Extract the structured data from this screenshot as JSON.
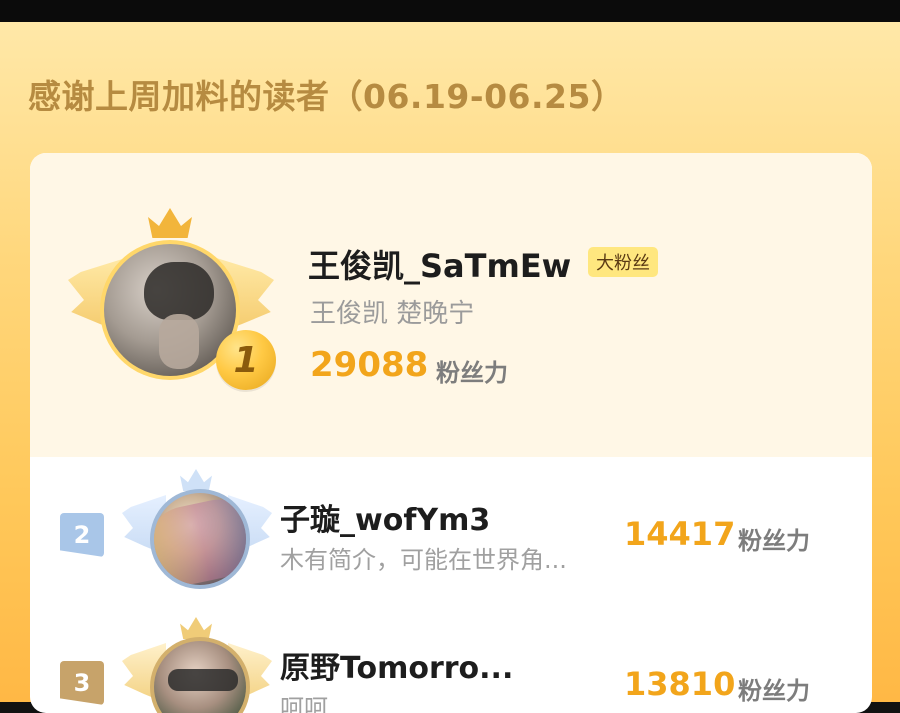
{
  "header": {
    "title": "感谢上周加料的读者（06.19-06.25）"
  },
  "top": {
    "rank": "1",
    "name": "王俊凯_SaTmEw",
    "tag": "大粉丝",
    "intro": "王俊凯 楚晚宁",
    "score": "29088",
    "score_unit": "粉丝力"
  },
  "list": [
    {
      "rank": "2",
      "name": "子璇_wofYm3",
      "intro": "木有简介，可能在世界角...",
      "score": "14417",
      "score_unit": "粉丝力"
    },
    {
      "rank": "3",
      "name": "原野Tomorro...",
      "intro": "呵呵",
      "score": "13810",
      "score_unit": "粉丝力"
    }
  ],
  "colors": {
    "score": "#f2a51b",
    "header": "#b68b41",
    "background_top": "#ffe8a8",
    "background_bottom": "#ffb845",
    "card_top_panel": "#fff7e6"
  },
  "icons": {
    "crown": "crown-icon",
    "wings": "wings-icon",
    "rank_medal": "rank-medal-icon"
  }
}
